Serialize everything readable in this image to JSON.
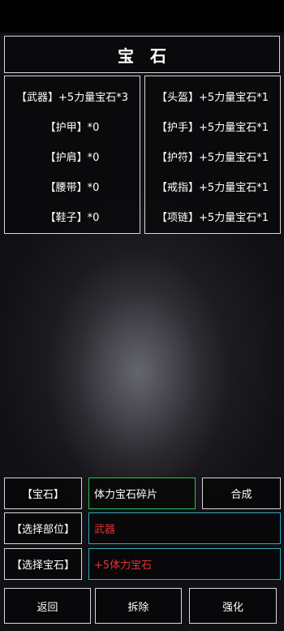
{
  "title": "宝石",
  "left_slots": [
    {
      "label": "【武器】",
      "value": "+5力量宝石*3"
    },
    {
      "label": "【护甲】",
      "value": "*0"
    },
    {
      "label": "【护肩】",
      "value": "*0"
    },
    {
      "label": "【腰带】",
      "value": "*0"
    },
    {
      "label": "【鞋子】",
      "value": "*0"
    }
  ],
  "right_slots": [
    {
      "label": "【头盔】",
      "value": "+5力量宝石*1"
    },
    {
      "label": "【护手】",
      "value": "+5力量宝石*1"
    },
    {
      "label": "【护符】",
      "value": "+5力量宝石*1"
    },
    {
      "label": "【戒指】",
      "value": "+5力量宝石*1"
    },
    {
      "label": "【项链】",
      "value": "+5力量宝石*1"
    }
  ],
  "gem_row": {
    "label": "【宝石】",
    "value": "体力宝石碎片",
    "action": "合成"
  },
  "part_row": {
    "label": "【选择部位】",
    "value": "武器"
  },
  "select_gem_row": {
    "label": "【选择宝石】",
    "value": "+5体力宝石"
  },
  "bottom_buttons": {
    "back": "返回",
    "remove": "拆除",
    "enhance": "强化"
  },
  "colors": {
    "green_border": "#2fc24a",
    "cyan_border": "#2ea8b8",
    "red_text": "#e23333"
  }
}
